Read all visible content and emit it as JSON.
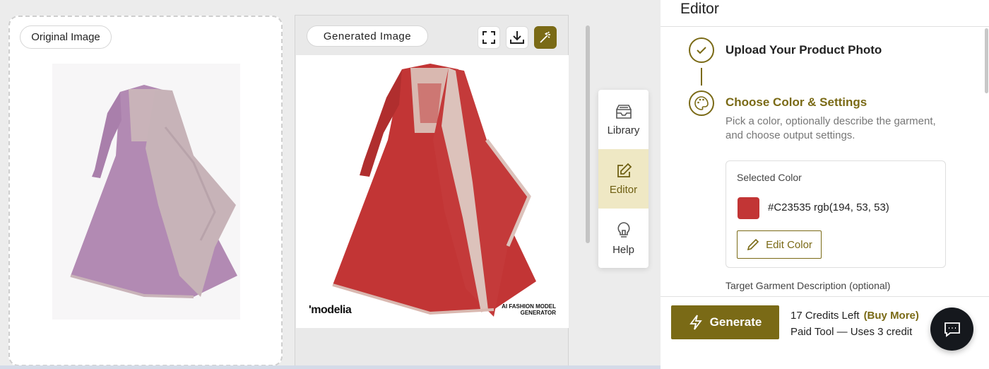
{
  "original": {
    "label": "Original Image"
  },
  "generated": {
    "label": "Generated Image",
    "watermark_left": "'modelia",
    "watermark_right_line1": "AI FASHION MODEL",
    "watermark_right_line2": "GENERATOR"
  },
  "toolbar": {
    "fullscreen_icon": "fullscreen-icon",
    "download_icon": "download-icon",
    "magic_icon": "magic-wand-icon"
  },
  "nav": {
    "items": [
      {
        "label": "Library",
        "icon": "inbox-icon",
        "active": false
      },
      {
        "label": "Editor",
        "icon": "edit-icon",
        "active": true
      },
      {
        "label": "Help",
        "icon": "lightbulb-icon",
        "active": false
      }
    ]
  },
  "editor": {
    "title": "Editor",
    "step1": {
      "title": "Upload Your Product Photo"
    },
    "step2": {
      "title": "Choose Color & Settings",
      "description": "Pick a color, optionally describe the garment, and choose output settings."
    },
    "selected_color": {
      "label": "Selected Color",
      "value": "#C23535 rgb(194, 53, 53)",
      "hex": "#C23535",
      "edit_label": "Edit Color"
    },
    "target_description_label": "Target Garment Description (optional)"
  },
  "footer": {
    "generate_label": "Generate",
    "credits_left": "17 Credits Left",
    "buy_more": "(Buy More)",
    "paid_note": "Paid Tool — Uses 3 credit"
  },
  "colors": {
    "accent": "#7A6A16",
    "accent_light": "#EFE8C4",
    "garment_original": "#B48AB5",
    "garment_generated": "#C23535"
  }
}
